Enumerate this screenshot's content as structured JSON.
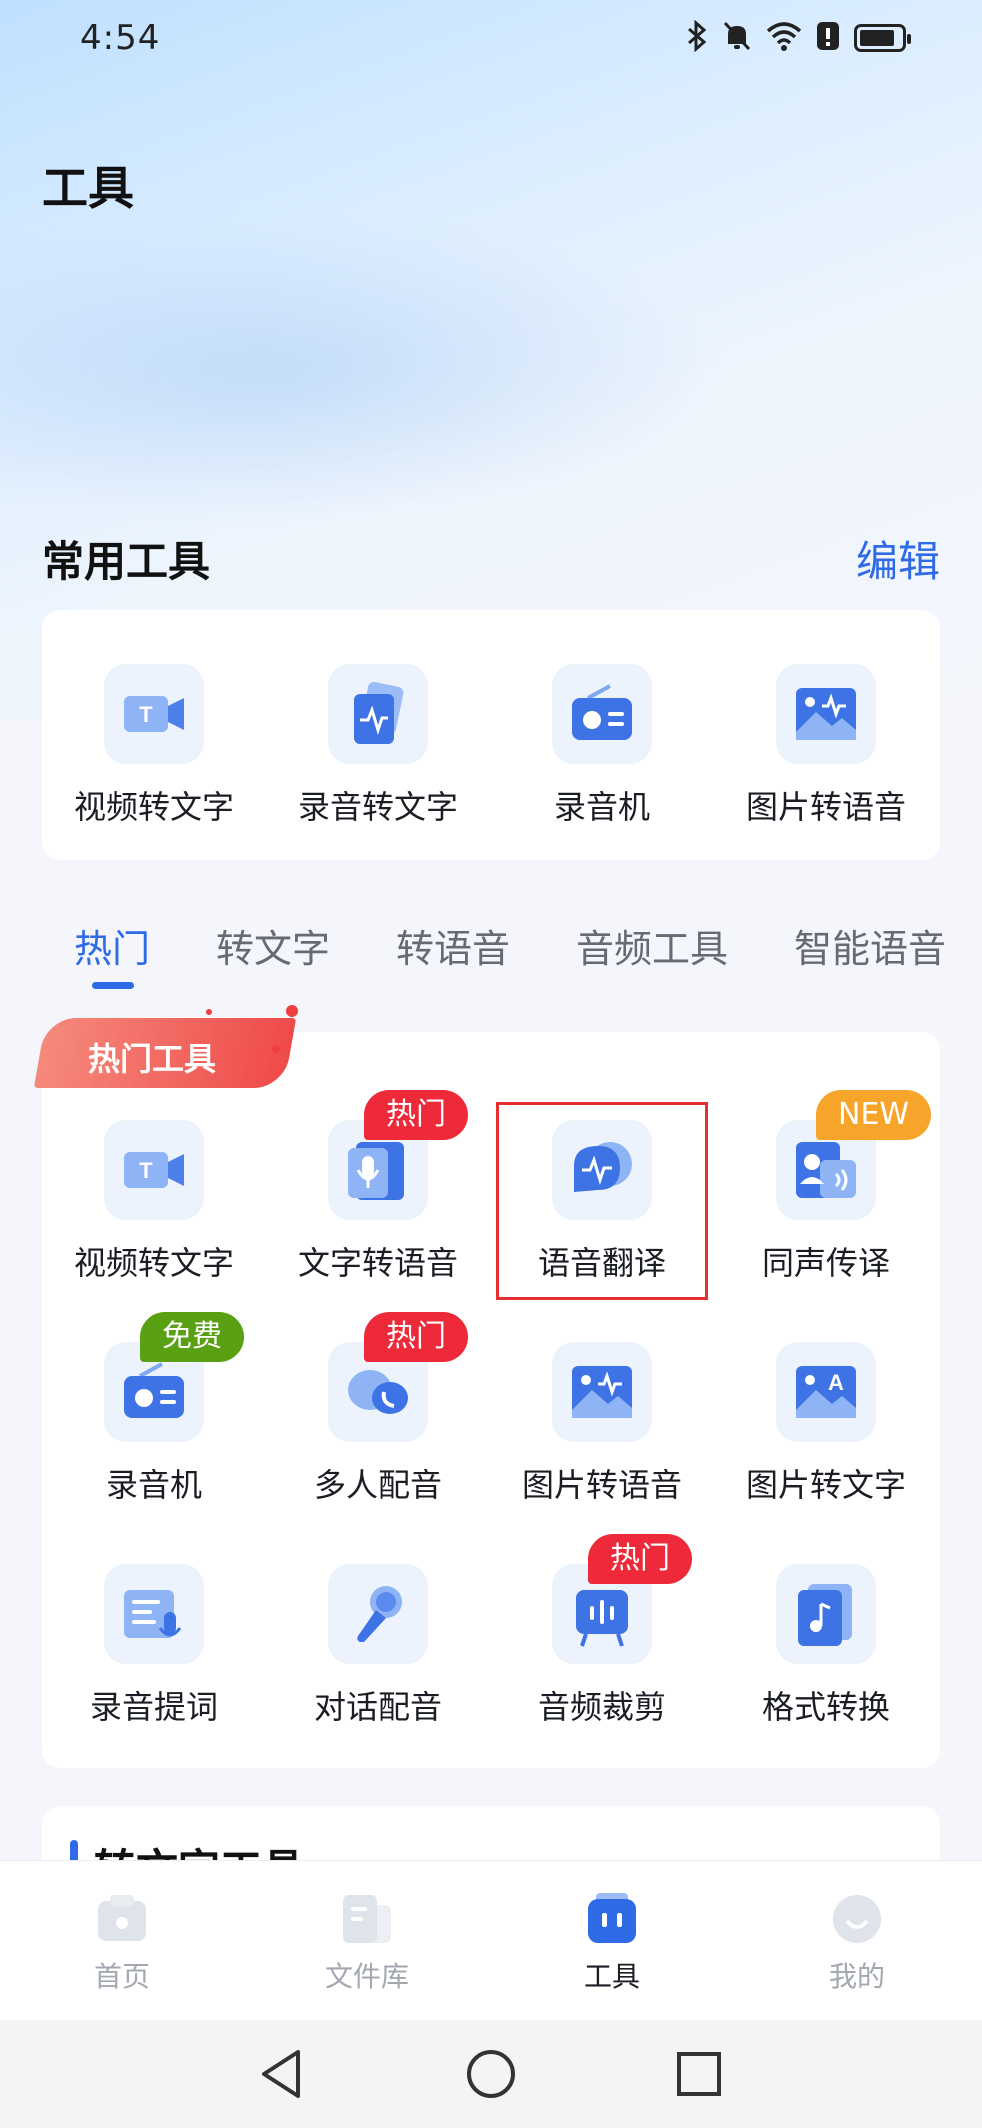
{
  "status_bar": {
    "time": "4:54",
    "icons": [
      "bluetooth-icon",
      "mute-icon",
      "wifi-icon",
      "alert-icon",
      "battery-icon"
    ],
    "battery_level": 0.8
  },
  "page_title": "工具",
  "common_tools": {
    "title": "常用工具",
    "edit_label": "编辑",
    "items": [
      {
        "label": "视频转文字",
        "icon": "video-text-icon"
      },
      {
        "label": "录音转文字",
        "icon": "recording-text-icon"
      },
      {
        "label": "录音机",
        "icon": "recorder-icon"
      },
      {
        "label": "图片转语音",
        "icon": "image-voice-icon"
      }
    ]
  },
  "tabs": [
    "热门",
    "转文字",
    "转语音",
    "音频工具",
    "智能语音"
  ],
  "active_tab": "热门",
  "hot_tools": {
    "ribbon": "热门工具",
    "items": [
      {
        "label": "视频转文字",
        "icon": "video-text-icon",
        "badge": ""
      },
      {
        "label": "文字转语音",
        "icon": "text-voice-icon",
        "badge": "热门"
      },
      {
        "label": "语音翻译",
        "icon": "voice-translate-icon",
        "badge": ""
      },
      {
        "label": "同声传译",
        "icon": "simultaneous-interpret-icon",
        "badge": "NEW"
      },
      {
        "label": "录音机",
        "icon": "recorder-icon",
        "badge": "免费"
      },
      {
        "label": "多人配音",
        "icon": "multi-dubbing-icon",
        "badge": "热门"
      },
      {
        "label": "图片转语音",
        "icon": "image-voice-icon",
        "badge": ""
      },
      {
        "label": "图片转文字",
        "icon": "image-text-icon",
        "badge": ""
      },
      {
        "label": "录音提词",
        "icon": "teleprompter-icon",
        "badge": ""
      },
      {
        "label": "对话配音",
        "icon": "dialogue-dubbing-icon",
        "badge": ""
      },
      {
        "label": "音频裁剪",
        "icon": "audio-cut-icon",
        "badge": "热门"
      },
      {
        "label": "格式转换",
        "icon": "format-convert-icon",
        "badge": ""
      }
    ]
  },
  "next_section": {
    "title": "转文字工具"
  },
  "bottom_nav": [
    {
      "label": "首页",
      "icon": "home-icon"
    },
    {
      "label": "文件库",
      "icon": "file-library-icon"
    },
    {
      "label": "工具",
      "icon": "tools-icon"
    },
    {
      "label": "我的",
      "icon": "profile-icon"
    }
  ],
  "active_nav": "工具",
  "colors": {
    "accent": "#2f6be6",
    "hot": "#ee2a3a",
    "new": "#f7a52a",
    "free": "#5aa013"
  }
}
